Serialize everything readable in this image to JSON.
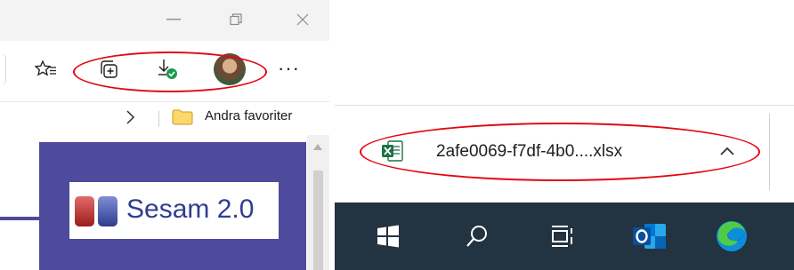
{
  "browser": {
    "window_controls": {
      "minimize": "—"
    },
    "favorites_bar": {
      "folder_label": "Andra favoriter"
    },
    "page": {
      "logo_text": "Sesam 2.0"
    }
  },
  "download_bar": {
    "file_name": "2afe0069-f7df-4b0....xlsx",
    "file_icon_letter": "x"
  },
  "taskbar": {
    "apps": [
      "windows-start-icon",
      "search-icon",
      "task-view-icon",
      "outlook-icon",
      "edge-icon"
    ]
  },
  "colors": {
    "annotation": "#e30613",
    "taskbar_bg": "#223341",
    "page_accent": "#4e4a9c",
    "excel_green": "#1e7145"
  }
}
